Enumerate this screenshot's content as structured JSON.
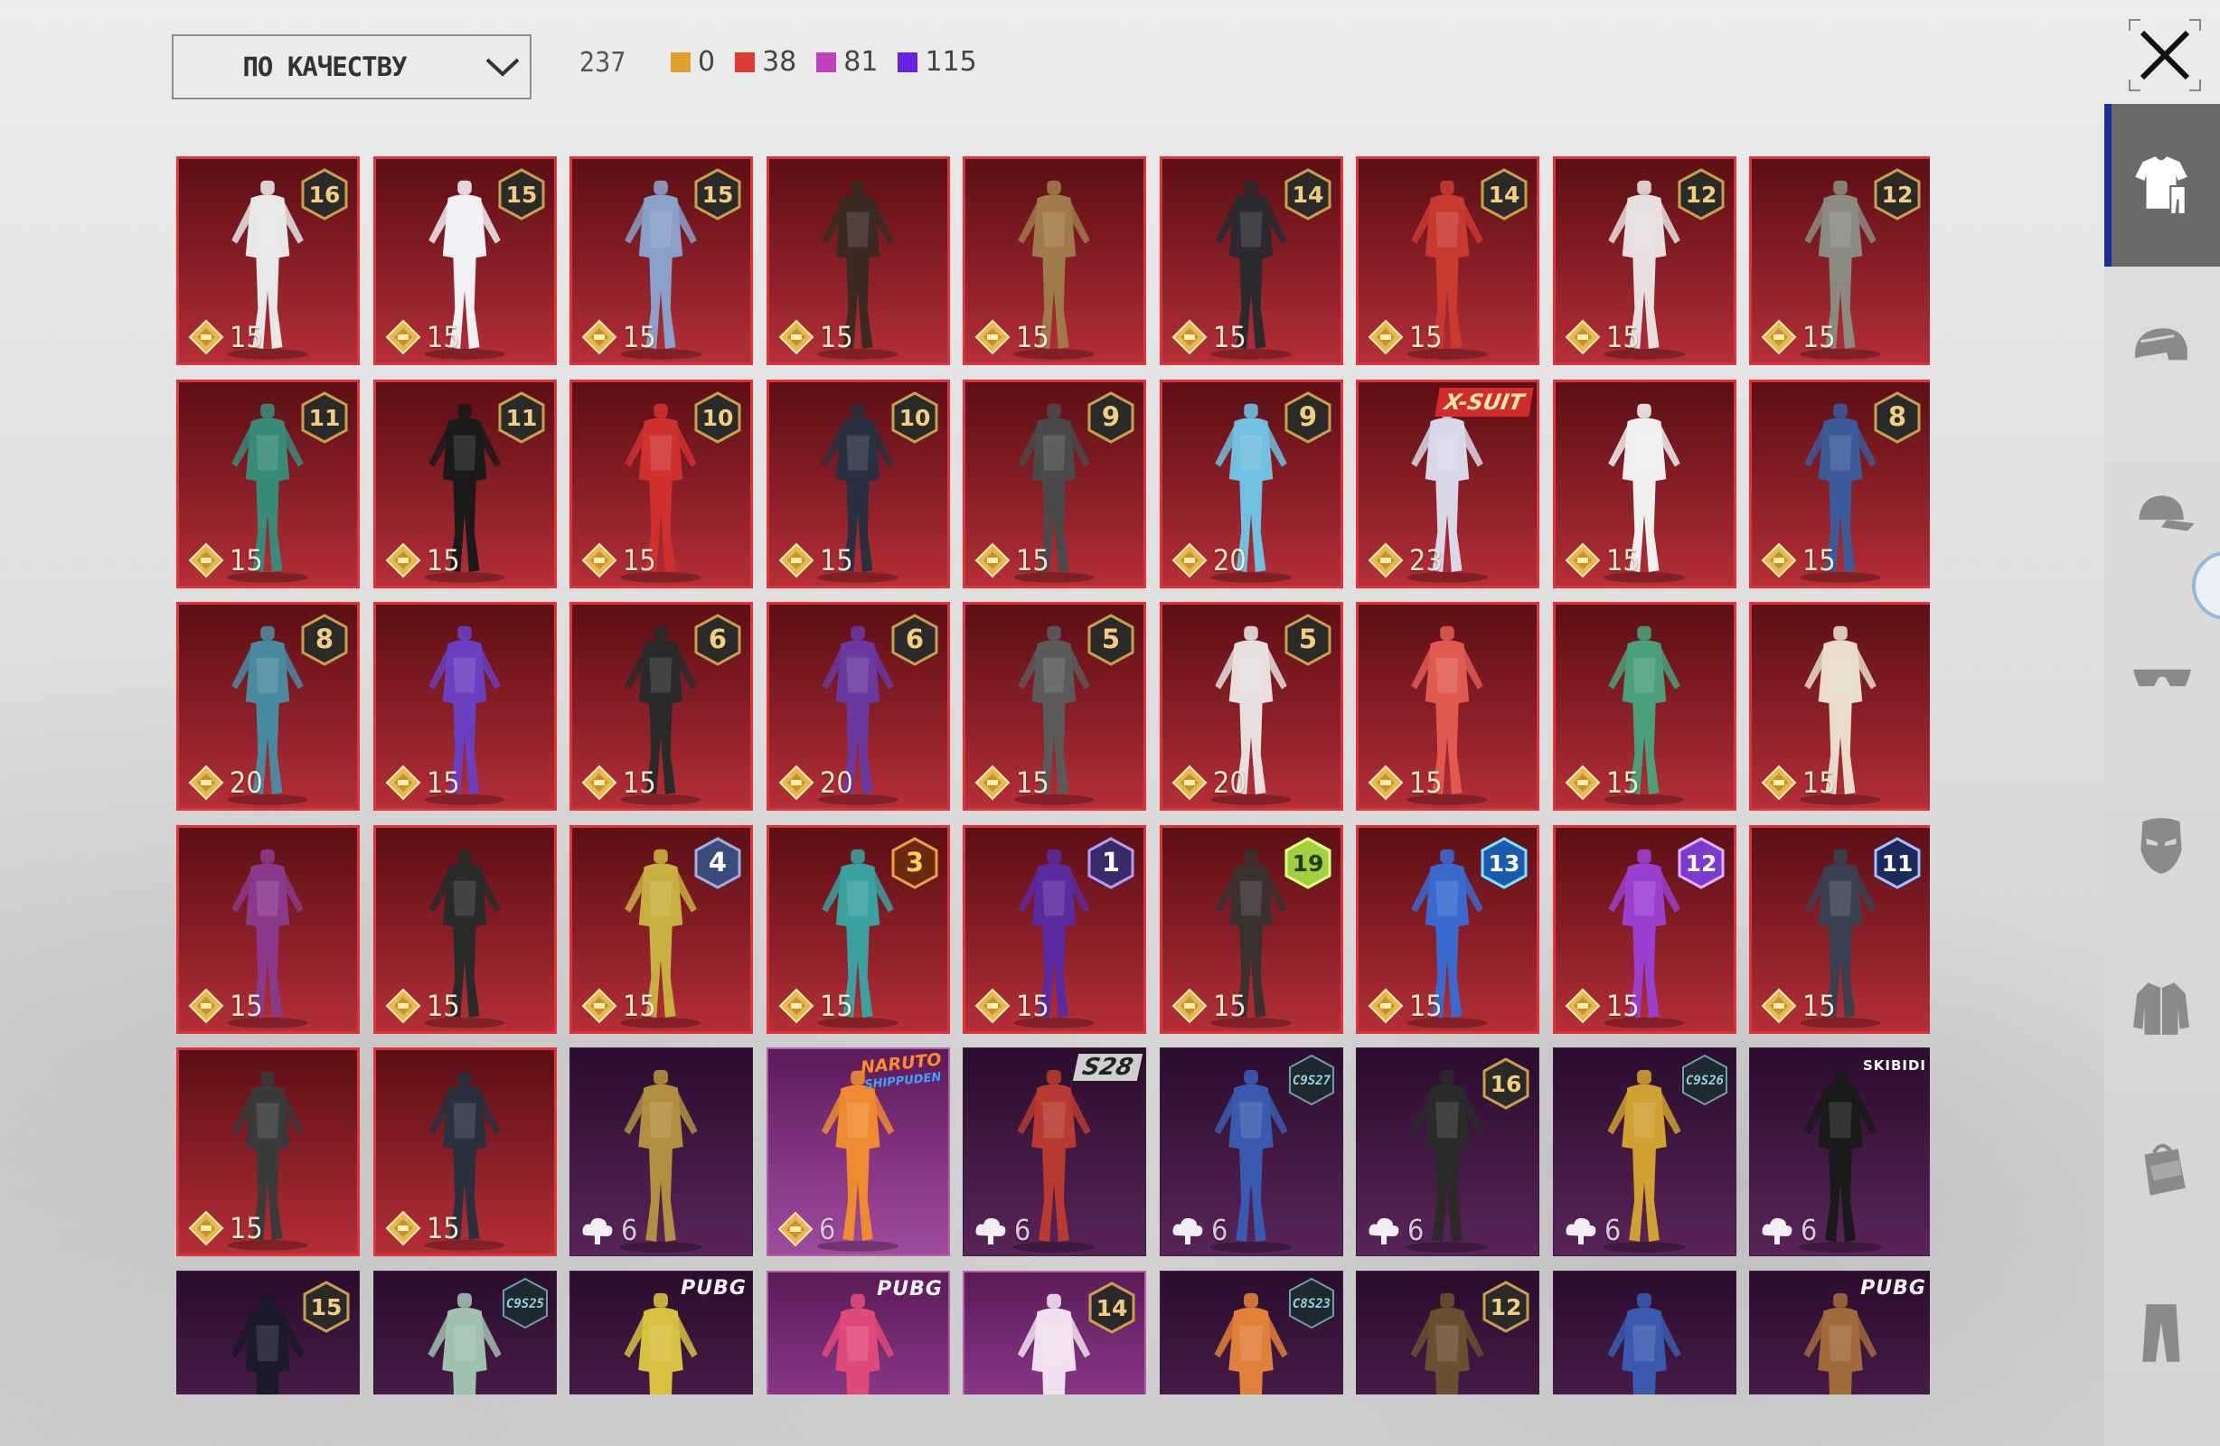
{
  "toolbar": {
    "sort_label": "ПО КАЧЕСТВУ",
    "total": "237",
    "counts": [
      {
        "color": "#e0a030",
        "value": "0"
      },
      {
        "color": "#e03a35",
        "value": "38"
      },
      {
        "color": "#c040c0",
        "value": "81"
      },
      {
        "color": "#6a22e0",
        "value": "115"
      }
    ]
  },
  "sidebar": {
    "items": [
      {
        "name": "outfit",
        "icon": "outfit-icon",
        "active": true
      },
      {
        "name": "helmet",
        "icon": "helmet-icon",
        "active": false
      },
      {
        "name": "hat",
        "icon": "cap-icon",
        "active": false
      },
      {
        "name": "eyewear",
        "icon": "glasses-icon",
        "active": false
      },
      {
        "name": "mask",
        "icon": "mask-icon",
        "active": false
      },
      {
        "name": "top",
        "icon": "jacket-icon",
        "active": false
      },
      {
        "name": "backpack",
        "icon": "backpack-icon",
        "active": false
      },
      {
        "name": "pants",
        "icon": "pants-icon",
        "active": false
      }
    ]
  },
  "items": [
    {
      "bg": "red",
      "badge": "16",
      "cost": "15",
      "currency": "coin",
      "fig": "#e8e8e8"
    },
    {
      "bg": "red",
      "badge": "15",
      "cost": "15",
      "currency": "coin",
      "fig": "#f0f0f5"
    },
    {
      "bg": "red",
      "badge": "15",
      "cost": "15",
      "currency": "coin",
      "fig": "#8aa0c8"
    },
    {
      "bg": "red",
      "badge": "",
      "cost": "15",
      "currency": "coin",
      "fig": "#3a2a22"
    },
    {
      "bg": "red",
      "badge": "",
      "cost": "15",
      "currency": "coin",
      "fig": "#a07a4a"
    },
    {
      "bg": "red",
      "badge": "14",
      "cost": "15",
      "currency": "coin",
      "fig": "#2a2a30"
    },
    {
      "bg": "red",
      "badge": "14",
      "cost": "15",
      "currency": "coin",
      "fig": "#c83a30"
    },
    {
      "bg": "red",
      "badge": "12",
      "cost": "15",
      "currency": "coin",
      "fig": "#e8e0e0"
    },
    {
      "bg": "red",
      "badge": "12",
      "cost": "15",
      "currency": "coin",
      "fig": "#8a8a80"
    },
    {
      "bg": "red",
      "badge": "11",
      "cost": "15",
      "currency": "coin",
      "fig": "#3a8a7a"
    },
    {
      "bg": "red",
      "badge": "11",
      "cost": "15",
      "currency": "coin",
      "fig": "#1a1a1a"
    },
    {
      "bg": "red",
      "badge": "10",
      "cost": "15",
      "currency": "coin",
      "fig": "#d03030"
    },
    {
      "bg": "red",
      "badge": "10",
      "cost": "15",
      "currency": "coin",
      "fig": "#2a3040"
    },
    {
      "bg": "red",
      "badge": "9",
      "cost": "15",
      "currency": "coin",
      "fig": "#4a4a4a"
    },
    {
      "bg": "red",
      "badge": "9",
      "cost": "20",
      "currency": "coin",
      "fig": "#70c0e0"
    },
    {
      "bg": "red",
      "badge": "",
      "tag": "X-SUIT",
      "cost": "23",
      "currency": "coin",
      "fig": "#d8d8e8"
    },
    {
      "bg": "red",
      "badge": "",
      "cost": "15",
      "currency": "coin",
      "fig": "#f0f0f0"
    },
    {
      "bg": "red",
      "badge": "8",
      "cost": "15",
      "currency": "coin",
      "fig": "#3a5a9a"
    },
    {
      "bg": "red",
      "badge": "8",
      "cost": "20",
      "currency": "coin",
      "fig": "#4a8aa0"
    },
    {
      "bg": "red",
      "badge": "",
      "cost": "15",
      "currency": "coin",
      "fig": "#6a40c0"
    },
    {
      "bg": "red",
      "badge": "6",
      "cost": "15",
      "currency": "coin",
      "fig": "#2a2a2a"
    },
    {
      "bg": "red",
      "badge": "6",
      "cost": "20",
      "currency": "coin",
      "fig": "#6a3aa0"
    },
    {
      "bg": "red",
      "badge": "5",
      "cost": "15",
      "currency": "coin",
      "fig": "#5a5a5a"
    },
    {
      "bg": "red",
      "badge": "5",
      "cost": "20",
      "currency": "coin",
      "fig": "#e8e0e0"
    },
    {
      "bg": "red",
      "badge": "",
      "cost": "15",
      "currency": "coin",
      "fig": "#e05a50"
    },
    {
      "bg": "red",
      "badge": "",
      "cost": "15",
      "currency": "coin",
      "fig": "#4aa07a"
    },
    {
      "bg": "red",
      "badge": "",
      "cost": "15",
      "currency": "coin",
      "fig": "#e8dccc"
    },
    {
      "bg": "red",
      "badge": "",
      "cost": "15",
      "currency": "coin",
      "fig": "#8a3a8a"
    },
    {
      "bg": "red",
      "badge": "",
      "cost": "15",
      "currency": "coin",
      "fig": "#2a2a2a"
    },
    {
      "bg": "red",
      "badge": "4",
      "badgeStyle": "blue",
      "cost": "15",
      "currency": "coin",
      "fig": "#c8b040"
    },
    {
      "bg": "red",
      "badge": "3",
      "badgeStyle": "orange",
      "cost": "15",
      "currency": "coin",
      "fig": "#3aa0a0"
    },
    {
      "bg": "red",
      "badge": "1",
      "badgeStyle": "purple",
      "cost": "15",
      "currency": "coin",
      "fig": "#5a2aa0"
    },
    {
      "bg": "red",
      "badge": "19",
      "badgeStyle": "lime",
      "cost": "15",
      "currency": "coin",
      "fig": "#3a3030"
    },
    {
      "bg": "red",
      "badge": "13",
      "badgeStyle": "cyan",
      "cost": "15",
      "currency": "coin",
      "fig": "#3a6ad0"
    },
    {
      "bg": "red",
      "badge": "12",
      "badgeStyle": "violet",
      "cost": "15",
      "currency": "coin",
      "fig": "#9a40d0"
    },
    {
      "bg": "red",
      "badge": "11",
      "badgeStyle": "navy",
      "cost": "15",
      "currency": "coin",
      "fig": "#3a4050"
    },
    {
      "bg": "red",
      "badge": "",
      "cost": "15",
      "currency": "coin",
      "fig": "#3a3a3a"
    },
    {
      "bg": "red",
      "badge": "",
      "cost": "15",
      "currency": "coin",
      "fig": "#2a3040"
    },
    {
      "bg": "purple",
      "badge": "",
      "cost": "6",
      "currency": "cloud",
      "fig": "#b09040"
    },
    {
      "bg": "pink",
      "badge": "",
      "tag": "NARUTO",
      "tagSub": "SHIPPUDEN",
      "cost": "6",
      "currency": "coin",
      "fig": "#f08a30"
    },
    {
      "bg": "purple",
      "badge": "",
      "tag": "S28",
      "cost": "6",
      "currency": "cloud",
      "fig": "#b83a30"
    },
    {
      "bg": "purple",
      "badge": "",
      "tag": "C9S27",
      "cost": "6",
      "currency": "cloud",
      "fig": "#3a5ab0"
    },
    {
      "bg": "purple",
      "badge": "16",
      "cost": "6",
      "currency": "cloud",
      "fig": "#2a2a2a"
    },
    {
      "bg": "purple",
      "badge": "",
      "tag": "C9S26",
      "cost": "6",
      "currency": "cloud",
      "fig": "#d0a030"
    },
    {
      "bg": "purple",
      "badge": "",
      "tag": "SKIBIDI",
      "cost": "6",
      "currency": "cloud",
      "fig": "#1a1a1a"
    },
    {
      "bg": "purple",
      "badge": "15",
      "cost": "",
      "currency": "",
      "fig": "#1a1a2a"
    },
    {
      "bg": "purple",
      "badge": "",
      "tag": "C9S25",
      "cost": "",
      "currency": "",
      "fig": "#a0c0b0"
    },
    {
      "bg": "purple",
      "badge": "",
      "tag": "PUBG",
      "cost": "",
      "currency": "",
      "fig": "#d8c040"
    },
    {
      "bg": "pink",
      "badge": "",
      "tag": "PUBG",
      "cost": "",
      "currency": "",
      "fig": "#e04a7a"
    },
    {
      "bg": "pink",
      "badge": "14",
      "cost": "",
      "currency": "",
      "fig": "#f0e0f0"
    },
    {
      "bg": "purple",
      "badge": "",
      "tag": "C8S23",
      "cost": "",
      "currency": "",
      "fig": "#e0803a"
    },
    {
      "bg": "purple",
      "badge": "12",
      "cost": "",
      "currency": "",
      "fig": "#6a5030"
    },
    {
      "bg": "purple",
      "badge": "",
      "cost": "",
      "currency": "",
      "fig": "#3a5ab0"
    },
    {
      "bg": "purple",
      "badge": "",
      "tag": "PUBG",
      "cost": "",
      "currency": "",
      "fig": "#a06a3a"
    }
  ]
}
